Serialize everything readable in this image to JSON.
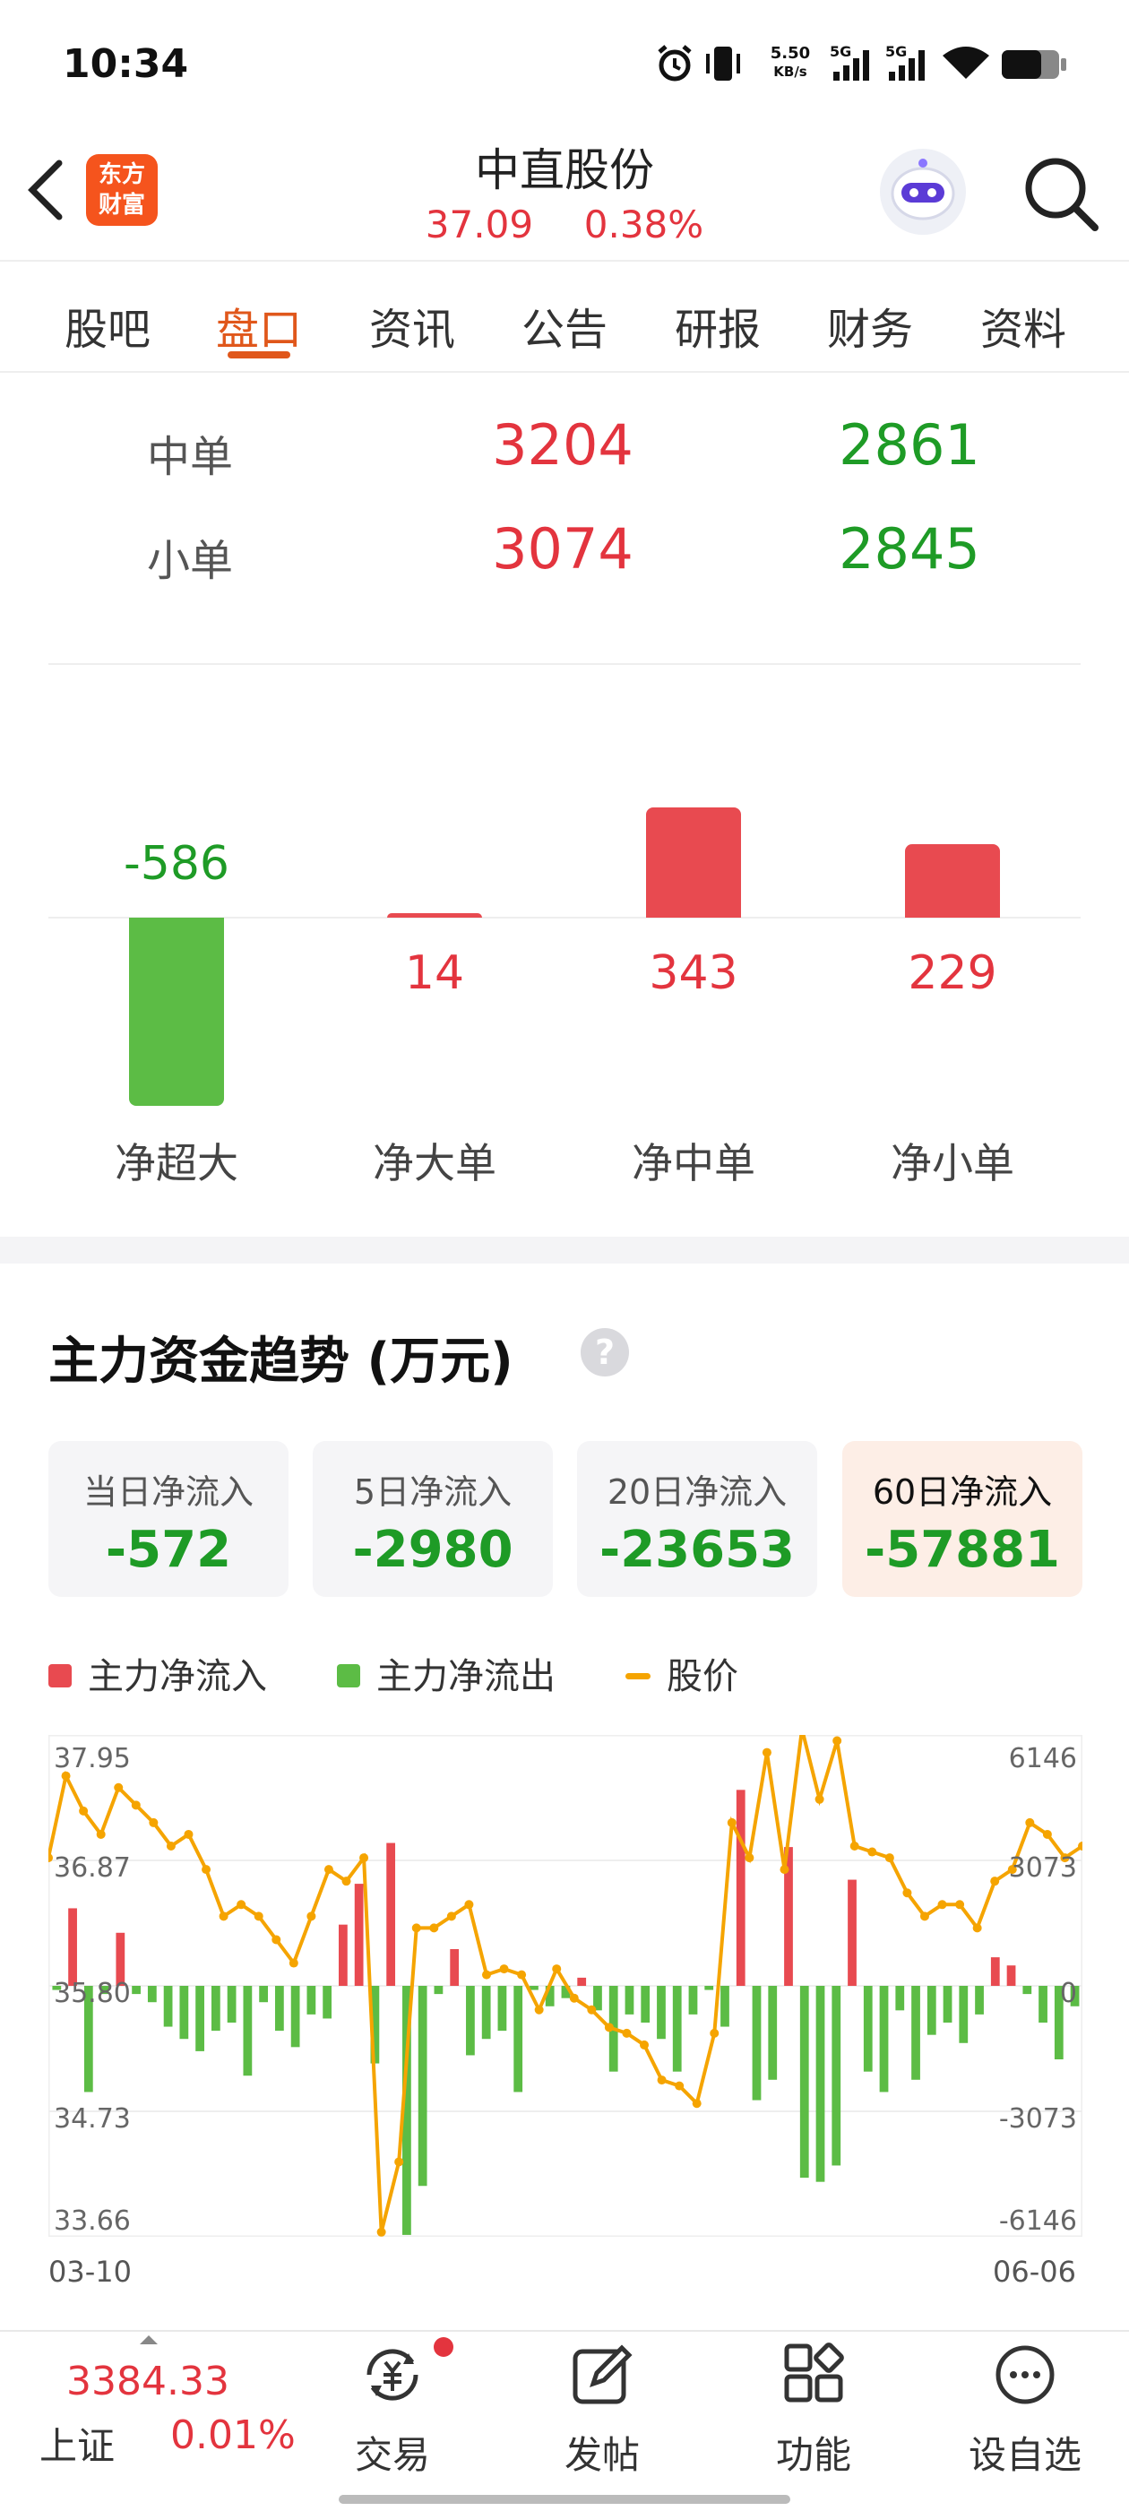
{
  "status_bar": {
    "time": "10:34",
    "net_speed_value": "5.50",
    "net_speed_unit": "KB/s",
    "sim1": "5G",
    "sim2": "5G",
    "icons": [
      "alarm-icon",
      "vibrate-icon",
      "signal-icon",
      "signal-icon",
      "wifi-icon",
      "battery-icon"
    ]
  },
  "header": {
    "logo_line1": "东方",
    "logo_line2": "财富",
    "stock_name": "中直股份",
    "price": "37.09",
    "change_pct": "0.38%"
  },
  "tabs": [
    {
      "label": "股吧",
      "active": false
    },
    {
      "label": "盘口",
      "active": true
    },
    {
      "label": "资讯",
      "active": false
    },
    {
      "label": "公告",
      "active": false
    },
    {
      "label": "研报",
      "active": false
    },
    {
      "label": "财务",
      "active": false
    },
    {
      "label": "资料",
      "active": false
    }
  ],
  "orders": [
    {
      "label": "中单",
      "buy": "3204",
      "sell": "2861"
    },
    {
      "label": "小单",
      "buy": "3074",
      "sell": "2845"
    }
  ],
  "net_flows": [
    {
      "label": "净超大",
      "value": -586
    },
    {
      "label": "净大单",
      "value": 14
    },
    {
      "label": "净中单",
      "value": 343
    },
    {
      "label": "净小单",
      "value": 229
    }
  ],
  "trend": {
    "title": "主力资金趋势 (万元)",
    "help": "?",
    "periods": [
      {
        "label": "当日净流入",
        "value": "-572",
        "active": false
      },
      {
        "label": "5日净流入",
        "value": "-2980",
        "active": false
      },
      {
        "label": "20日净流入",
        "value": "-23653",
        "active": false
      },
      {
        "label": "60日净流入",
        "value": "-57881",
        "active": true
      }
    ],
    "legend": [
      {
        "label": "主力净流入",
        "color": "#e84a50"
      },
      {
        "label": "主力净流出",
        "color": "#5cbc45"
      },
      {
        "label": "股价",
        "color": "#f5a400"
      }
    ]
  },
  "chart_data": {
    "type": "bar",
    "x_start": "03-10",
    "x_end": "06-06",
    "left_axis_ticks": [
      "37.95",
      "36.87",
      "35.80",
      "34.73",
      "33.66"
    ],
    "right_axis_ticks": [
      "6146",
      "3073",
      "0",
      "-3073",
      "-6146"
    ],
    "y_left_range": [
      33.66,
      37.95
    ],
    "y_right_range": [
      -6146,
      6146
    ],
    "grid": true,
    "series": [
      {
        "name": "主力净流入/流出",
        "values": [
          -100,
          1900,
          -2600,
          -200,
          1300,
          -200,
          -400,
          -1000,
          -1300,
          -1600,
          -1100,
          -900,
          -2200,
          -400,
          -1100,
          -1500,
          -700,
          -800,
          1500,
          2500,
          -1900,
          3500,
          -6100,
          -4900,
          -200,
          900,
          -1700,
          -1300,
          -1100,
          -2600,
          -100,
          -500,
          -300,
          200,
          -600,
          -2100,
          -700,
          -900,
          -1300,
          -2100,
          -700,
          -100,
          -1000,
          4800,
          -2800,
          -2300,
          3400,
          -4700,
          -4800,
          -4400,
          2600,
          -2100,
          -2600,
          -600,
          -2300,
          -1200,
          -900,
          -1400,
          -700,
          700,
          500,
          -200,
          -900,
          -1800,
          -500
        ],
        "colors": {
          "positive": "#e84a50",
          "negative": "#5cbc45"
        }
      },
      {
        "name": "股价",
        "values": [
          36.9,
          37.6,
          37.3,
          37.1,
          37.5,
          37.35,
          37.2,
          37.0,
          37.1,
          36.8,
          36.4,
          36.5,
          36.4,
          36.2,
          36.0,
          36.4,
          36.8,
          36.7,
          36.9,
          33.7,
          34.3,
          36.3,
          36.3,
          36.4,
          36.5,
          35.9,
          35.95,
          35.9,
          35.6,
          35.95,
          35.7,
          35.6,
          35.45,
          35.4,
          35.3,
          35.0,
          34.95,
          34.8,
          35.4,
          37.2,
          36.9,
          37.8,
          36.8,
          38.0,
          37.4,
          37.9,
          37.0,
          36.95,
          36.9,
          36.6,
          36.4,
          36.5,
          36.5,
          36.3,
          36.7,
          36.8,
          37.2,
          37.1,
          36.9,
          37.0
        ]
      }
    ]
  },
  "bottom_nav": {
    "index_value": "3384.33",
    "index_name": "上证",
    "index_pct": "0.01%",
    "items": [
      {
        "label": "交易",
        "icon": "trade-icon"
      },
      {
        "label": "发帖",
        "icon": "compose-icon"
      },
      {
        "label": "功能",
        "icon": "apps-icon"
      },
      {
        "label": "设自选",
        "icon": "more-icon"
      }
    ]
  }
}
